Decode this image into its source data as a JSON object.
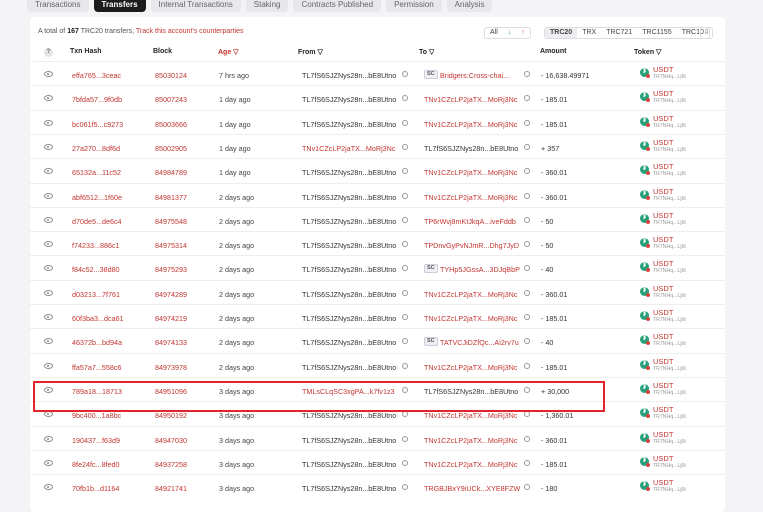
{
  "tabs": [
    {
      "label": "Transactions",
      "active": false
    },
    {
      "label": "Transfers",
      "active": true
    },
    {
      "label": "Internal Transactions",
      "active": false
    },
    {
      "label": "Staking",
      "active": false
    },
    {
      "label": "Contracts Published",
      "active": false
    },
    {
      "label": "Permission",
      "active": false
    },
    {
      "label": "Analysis",
      "active": false
    }
  ],
  "summary": {
    "prefix": "A total of",
    "count": "167",
    "suffix": "TRC20 transfers,",
    "link": "Track this account's counterparties"
  },
  "direction_filter": {
    "all": "All",
    "in": "↓",
    "out": "↑"
  },
  "token_filter": [
    "TRC20",
    "TRX",
    "TRC721",
    "TRC1155",
    "TRC10"
  ],
  "export_icon": "export-icon",
  "columns": {
    "help": "?",
    "hash": "Txn Hash",
    "block": "Block",
    "age": "Age",
    "from": "From",
    "to": "To",
    "amount": "Amount",
    "token": "Token"
  },
  "rows": [
    {
      "hash": "effa765...3ceac",
      "block": "85030124",
      "age": "7 hrs ago",
      "from": "TL7fS6SJZNys28n...bE8Utno",
      "to": "Bridgers:Cross-chai...",
      "to_sc": true,
      "amount": "- 16,638.49971",
      "token": "USDT",
      "token_sub": "TR7NHq...Lj6t"
    },
    {
      "hash": "7bfda57...9f0db",
      "block": "85007243",
      "age": "1 day ago",
      "from": "TL7fS6SJZNys28n...bE8Utno",
      "to": "TNv1CZcLP2jaTX...MoRj3Nc",
      "to_sc": false,
      "amount": "- 185.01",
      "token": "USDT",
      "token_sub": "TR7NHq...Lj6t"
    },
    {
      "hash": "bc061f5...c9273",
      "block": "85003666",
      "age": "1 day ago",
      "from": "TL7fS6SJZNys28n...bE8Utno",
      "to": "TNv1CZcLP2jaTX...MoRj3Nc",
      "to_sc": false,
      "amount": "- 185.01",
      "token": "USDT",
      "token_sub": "TR7NHq...Lj6t"
    },
    {
      "hash": "27a270...8df6d",
      "block": "85002905",
      "age": "1 day ago",
      "from": "TNv1CZcLP2jaTX...MoRj3Nc",
      "from_red": true,
      "to": "TL7fS6SJZNys28n...bE8Utno",
      "to_plain": true,
      "to_sc": false,
      "amount": "+ 357",
      "token": "USDT",
      "token_sub": "TR7NHq...Lj6t"
    },
    {
      "hash": "65132a...11c52",
      "block": "84984789",
      "age": "1 day ago",
      "from": "TL7fS6SJZNys28n...bE8Utno",
      "to": "TNv1CZcLP2jaTX...MoRj3Nc",
      "to_sc": false,
      "amount": "- 360.01",
      "token": "USDT",
      "token_sub": "TR7NHq...Lj6t"
    },
    {
      "hash": "abf6512...1f60e",
      "block": "84981377",
      "age": "2 days ago",
      "from": "TL7fS6SJZNys28n...bE8Utno",
      "to": "TNv1CZcLP2jaTX...MoRj3Nc",
      "to_sc": false,
      "amount": "- 360.01",
      "token": "USDT",
      "token_sub": "TR7NHq...Lj6t"
    },
    {
      "hash": "d70de5...de6c4",
      "block": "84975548",
      "age": "2 days ago",
      "from": "TL7fS6SJZNys28n...bE8Utno",
      "to": "TP6rWvj8mKtJkqA...iveFddb",
      "to_sc": false,
      "amount": "- 50",
      "token": "USDT",
      "token_sub": "TR7NHq...Lj6t"
    },
    {
      "hash": "f74233...886c1",
      "block": "84975314",
      "age": "2 days ago",
      "from": "TL7fS6SJZNys28n...bE8Utno",
      "to": "TPDnvGyPvNJmR...Dhg7JyD",
      "to_sc": false,
      "amount": "- 50",
      "token": "USDT",
      "token_sub": "TR7NHq...Lj6t"
    },
    {
      "hash": "f84c52...38d80",
      "block": "84975293",
      "age": "2 days ago",
      "from": "TL7fS6SJZNys28n...bE8Utno",
      "to": "TYHp5JGssA...3DJqBbP",
      "to_sc": true,
      "amount": "- 40",
      "token": "USDT",
      "token_sub": "TR7NHq...Lj6t"
    },
    {
      "hash": "d03213...7f761",
      "block": "84974289",
      "age": "2 days ago",
      "from": "TL7fS6SJZNys28n...bE8Utno",
      "to": "TNv1CZcLP2jaTX...MoRj3Nc",
      "to_sc": false,
      "amount": "- 360.01",
      "token": "USDT",
      "token_sub": "TR7NHq...Lj6t"
    },
    {
      "hash": "60f3ba3...dca61",
      "block": "84974219",
      "age": "2 days ago",
      "from": "TL7fS6SJZNys28n...bE8Utno",
      "to": "TNv1CZcLP2jaTX...MoRj3Nc",
      "to_sc": false,
      "amount": "- 185.01",
      "token": "USDT",
      "token_sub": "TR7NHq...Lj6t"
    },
    {
      "hash": "46372b...bd94a",
      "block": "84974133",
      "age": "2 days ago",
      "from": "TL7fS6SJZNys28n...bE8Utno",
      "to": "TATVCJiDZfQc...Ai2rv7u",
      "to_sc": true,
      "amount": "- 40",
      "token": "USDT",
      "token_sub": "TR7NHq...Lj6t"
    },
    {
      "hash": "ffa57a7...558c6",
      "block": "84973978",
      "age": "2 days ago",
      "from": "TL7fS6SJZNys28n...bE8Utno",
      "to": "TNv1CZcLP2jaTX...MoRj3Nc",
      "to_sc": false,
      "amount": "- 185.01",
      "token": "USDT",
      "token_sub": "TR7NHq...Lj6t"
    },
    {
      "hash": "789a18...18713",
      "block": "84951096",
      "age": "3 days ago",
      "from": "TMLsCLqSC3xgPA...k7fv1z3",
      "from_red": true,
      "to": "TL7fS6SJZNys28n...bE8Utno",
      "to_plain": true,
      "to_sc": false,
      "amount": "+ 30,000",
      "token": "USDT",
      "token_sub": "TR7NHq...Lj6t"
    },
    {
      "hash": "9bc400...1a8bc",
      "block": "84950192",
      "age": "3 days ago",
      "from": "TL7fS6SJZNys28n...bE8Utno",
      "to": "TNv1CZcLP2jaTX...MoRj3Nc",
      "to_sc": false,
      "amount": "- 1,360.01",
      "token": "USDT",
      "token_sub": "TR7NHq...Lj6t"
    },
    {
      "hash": "190437...f63d9",
      "block": "84947030",
      "age": "3 days ago",
      "from": "TL7fS6SJZNys28n...bE8Utno",
      "to": "TNv1CZcLP2jaTX...MoRj3Nc",
      "to_sc": false,
      "amount": "- 360.01",
      "token": "USDT",
      "token_sub": "TR7NHq...Lj6t"
    },
    {
      "hash": "8fe24fc...8fed0",
      "block": "84937258",
      "age": "3 days ago",
      "from": "TL7fS6SJZNys28n...bE8Utno",
      "to": "TNv1CZcLP2jaTX...MoRj3Nc",
      "to_sc": false,
      "amount": "- 185.01",
      "token": "USDT",
      "token_sub": "TR7NHq...Lj6t"
    },
    {
      "hash": "70fb1b...d1164",
      "block": "84921741",
      "age": "3 days ago",
      "from": "TL7fS6SJZNys28n...bE8Utno",
      "to": "TRGBJBxY9iUCk...XYE8FZW",
      "to_sc": false,
      "amount": "- 180",
      "token": "USDT",
      "token_sub": "TR7NHq...Lj6t"
    }
  ],
  "colors": {
    "accent": "#c23631",
    "highlight": "#e0262b",
    "token_green": "#26a17b"
  }
}
